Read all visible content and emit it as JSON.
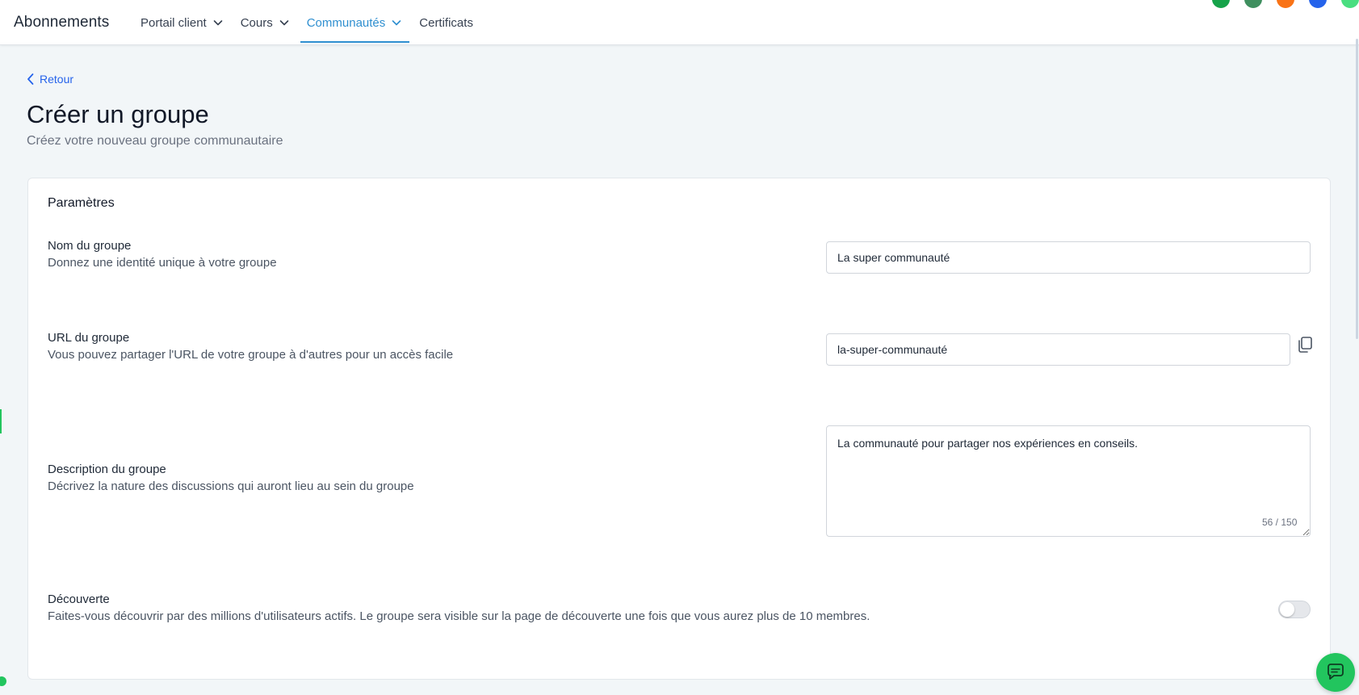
{
  "header": {
    "brand": "Abonnements",
    "nav": [
      {
        "label": "Portail client",
        "has_dropdown": true,
        "active": false
      },
      {
        "label": "Cours",
        "has_dropdown": true,
        "active": false
      },
      {
        "label": "Communautés",
        "has_dropdown": true,
        "active": true
      },
      {
        "label": "Certificats",
        "has_dropdown": false,
        "active": false
      }
    ],
    "avatar_colors": [
      "#16a34a",
      "#3f8f5f",
      "#f97316",
      "#2563eb",
      "#4ade80"
    ]
  },
  "page": {
    "back_label": "Retour",
    "title": "Créer un groupe",
    "subtitle": "Créez votre nouveau groupe communautaire"
  },
  "card": {
    "title": "Paramètres",
    "name": {
      "label": "Nom du groupe",
      "help": "Donnez une identité unique à votre groupe",
      "value": "La super communauté"
    },
    "url": {
      "label": "URL du groupe",
      "help": "Vous pouvez partager l'URL de votre groupe à d'autres pour un accès facile",
      "value": "la-super-communauté",
      "copy_icon": "copy-icon"
    },
    "description": {
      "label": "Description du groupe",
      "help": "Décrivez la nature des discussions qui auront lieu au sein du groupe",
      "value": "La communauté pour partager nos expériences en conseils.",
      "counter": "56 / 150"
    },
    "discovery": {
      "label": "Découverte",
      "help": "Faites-vous découvrir par des millions d'utilisateurs actifs. Le groupe sera visible sur la page de découverte une fois que vous aurez plus de 10 membres.",
      "enabled": false
    }
  },
  "colors": {
    "accent": "#2f8fd0",
    "link": "#2563eb",
    "chat": "#22c55e",
    "background": "#f2f6f8"
  },
  "chat_icon": "chat-icon"
}
